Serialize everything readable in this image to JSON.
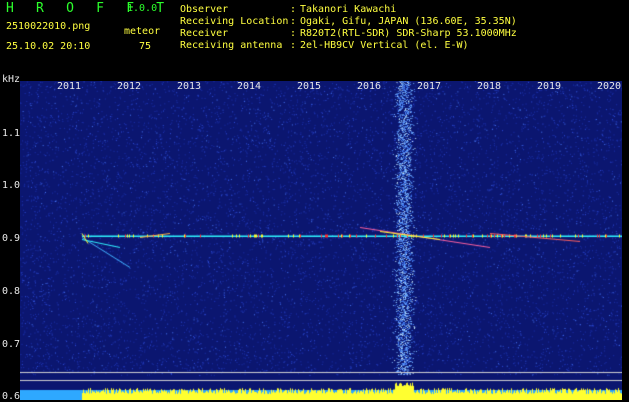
{
  "header": {
    "app_title": "H R O F F T",
    "app_version": "1.0.0",
    "file_name": "2510022010.png",
    "mode_label": "meteor",
    "date_time": "25.10.02 20:10",
    "meteor_count": "75",
    "info": [
      {
        "key": "Observer",
        "value": "Takanori Kawachi"
      },
      {
        "key": "Receiving Location",
        "value": "Ogaki, Gifu, JAPAN (136.60E, 35.35N)"
      },
      {
        "key": "Receiver",
        "value": "R820T2(RTL-SDR) SDR-Sharp 53.1000MHz"
      },
      {
        "key": "Receiving antenna",
        "value": "2el-HB9CV Vertical (el. E-W)"
      }
    ]
  },
  "spectrogram": {
    "unit": "kHz",
    "time_ticks": [
      "2011",
      "2012",
      "2013",
      "2014",
      "2015",
      "2016",
      "2017",
      "2018",
      "2019",
      "2020"
    ],
    "freq_ticks": [
      "1.1",
      "1.0",
      "0.9",
      "0.8",
      "0.7",
      "0.6"
    ],
    "freq_range": [
      0.595,
      1.2
    ],
    "carrier_freq": 0.907,
    "colors": {
      "background": "#0b1670",
      "noise": "#3050e0",
      "signal": "#2ff4ff",
      "strong": "#ffff30",
      "hot": "#ff3030"
    }
  }
}
